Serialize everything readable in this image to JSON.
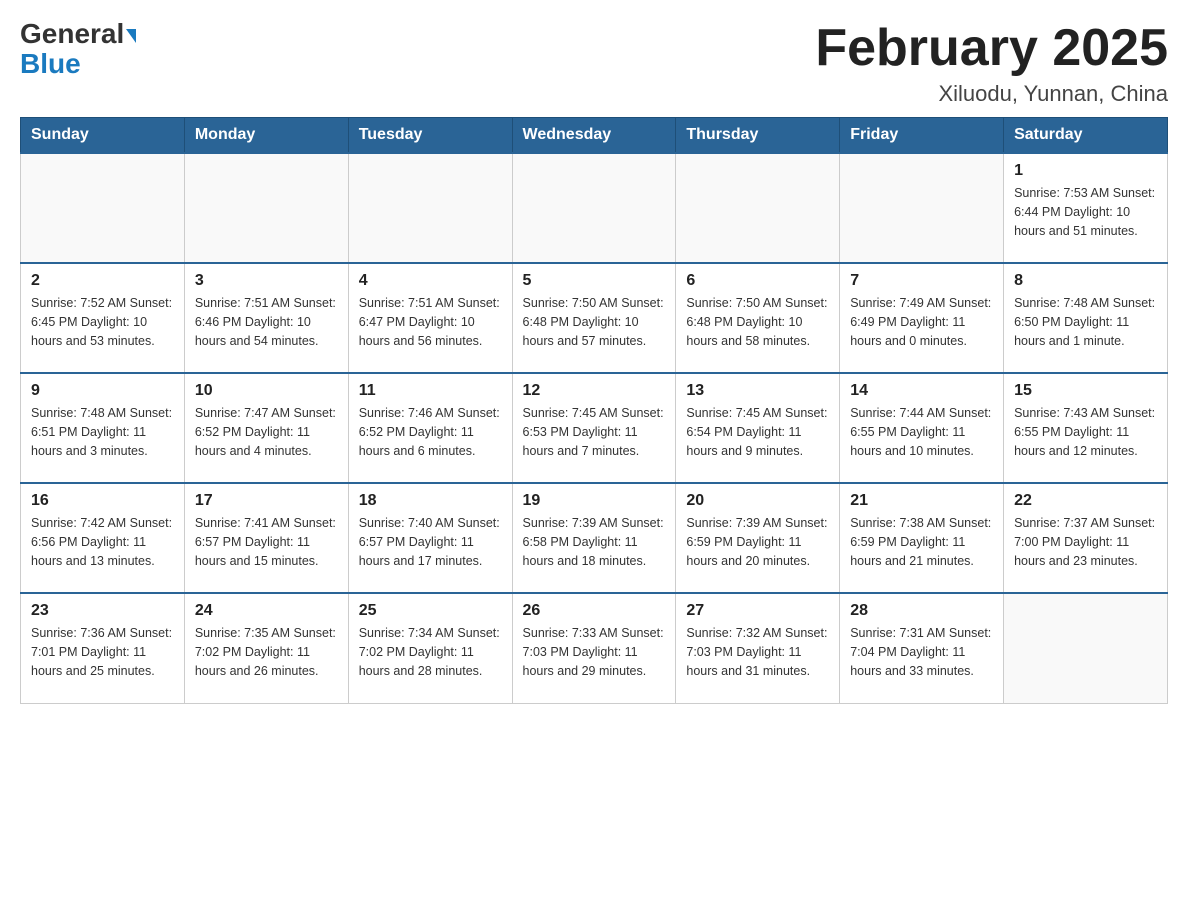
{
  "header": {
    "logo_general": "General",
    "logo_blue": "Blue",
    "title": "February 2025",
    "location": "Xiluodu, Yunnan, China"
  },
  "days_of_week": [
    "Sunday",
    "Monday",
    "Tuesday",
    "Wednesday",
    "Thursday",
    "Friday",
    "Saturday"
  ],
  "weeks": [
    [
      {
        "day": "",
        "info": ""
      },
      {
        "day": "",
        "info": ""
      },
      {
        "day": "",
        "info": ""
      },
      {
        "day": "",
        "info": ""
      },
      {
        "day": "",
        "info": ""
      },
      {
        "day": "",
        "info": ""
      },
      {
        "day": "1",
        "info": "Sunrise: 7:53 AM\nSunset: 6:44 PM\nDaylight: 10 hours and 51 minutes."
      }
    ],
    [
      {
        "day": "2",
        "info": "Sunrise: 7:52 AM\nSunset: 6:45 PM\nDaylight: 10 hours and 53 minutes."
      },
      {
        "day": "3",
        "info": "Sunrise: 7:51 AM\nSunset: 6:46 PM\nDaylight: 10 hours and 54 minutes."
      },
      {
        "day": "4",
        "info": "Sunrise: 7:51 AM\nSunset: 6:47 PM\nDaylight: 10 hours and 56 minutes."
      },
      {
        "day": "5",
        "info": "Sunrise: 7:50 AM\nSunset: 6:48 PM\nDaylight: 10 hours and 57 minutes."
      },
      {
        "day": "6",
        "info": "Sunrise: 7:50 AM\nSunset: 6:48 PM\nDaylight: 10 hours and 58 minutes."
      },
      {
        "day": "7",
        "info": "Sunrise: 7:49 AM\nSunset: 6:49 PM\nDaylight: 11 hours and 0 minutes."
      },
      {
        "day": "8",
        "info": "Sunrise: 7:48 AM\nSunset: 6:50 PM\nDaylight: 11 hours and 1 minute."
      }
    ],
    [
      {
        "day": "9",
        "info": "Sunrise: 7:48 AM\nSunset: 6:51 PM\nDaylight: 11 hours and 3 minutes."
      },
      {
        "day": "10",
        "info": "Sunrise: 7:47 AM\nSunset: 6:52 PM\nDaylight: 11 hours and 4 minutes."
      },
      {
        "day": "11",
        "info": "Sunrise: 7:46 AM\nSunset: 6:52 PM\nDaylight: 11 hours and 6 minutes."
      },
      {
        "day": "12",
        "info": "Sunrise: 7:45 AM\nSunset: 6:53 PM\nDaylight: 11 hours and 7 minutes."
      },
      {
        "day": "13",
        "info": "Sunrise: 7:45 AM\nSunset: 6:54 PM\nDaylight: 11 hours and 9 minutes."
      },
      {
        "day": "14",
        "info": "Sunrise: 7:44 AM\nSunset: 6:55 PM\nDaylight: 11 hours and 10 minutes."
      },
      {
        "day": "15",
        "info": "Sunrise: 7:43 AM\nSunset: 6:55 PM\nDaylight: 11 hours and 12 minutes."
      }
    ],
    [
      {
        "day": "16",
        "info": "Sunrise: 7:42 AM\nSunset: 6:56 PM\nDaylight: 11 hours and 13 minutes."
      },
      {
        "day": "17",
        "info": "Sunrise: 7:41 AM\nSunset: 6:57 PM\nDaylight: 11 hours and 15 minutes."
      },
      {
        "day": "18",
        "info": "Sunrise: 7:40 AM\nSunset: 6:57 PM\nDaylight: 11 hours and 17 minutes."
      },
      {
        "day": "19",
        "info": "Sunrise: 7:39 AM\nSunset: 6:58 PM\nDaylight: 11 hours and 18 minutes."
      },
      {
        "day": "20",
        "info": "Sunrise: 7:39 AM\nSunset: 6:59 PM\nDaylight: 11 hours and 20 minutes."
      },
      {
        "day": "21",
        "info": "Sunrise: 7:38 AM\nSunset: 6:59 PM\nDaylight: 11 hours and 21 minutes."
      },
      {
        "day": "22",
        "info": "Sunrise: 7:37 AM\nSunset: 7:00 PM\nDaylight: 11 hours and 23 minutes."
      }
    ],
    [
      {
        "day": "23",
        "info": "Sunrise: 7:36 AM\nSunset: 7:01 PM\nDaylight: 11 hours and 25 minutes."
      },
      {
        "day": "24",
        "info": "Sunrise: 7:35 AM\nSunset: 7:02 PM\nDaylight: 11 hours and 26 minutes."
      },
      {
        "day": "25",
        "info": "Sunrise: 7:34 AM\nSunset: 7:02 PM\nDaylight: 11 hours and 28 minutes."
      },
      {
        "day": "26",
        "info": "Sunrise: 7:33 AM\nSunset: 7:03 PM\nDaylight: 11 hours and 29 minutes."
      },
      {
        "day": "27",
        "info": "Sunrise: 7:32 AM\nSunset: 7:03 PM\nDaylight: 11 hours and 31 minutes."
      },
      {
        "day": "28",
        "info": "Sunrise: 7:31 AM\nSunset: 7:04 PM\nDaylight: 11 hours and 33 minutes."
      },
      {
        "day": "",
        "info": ""
      }
    ]
  ]
}
